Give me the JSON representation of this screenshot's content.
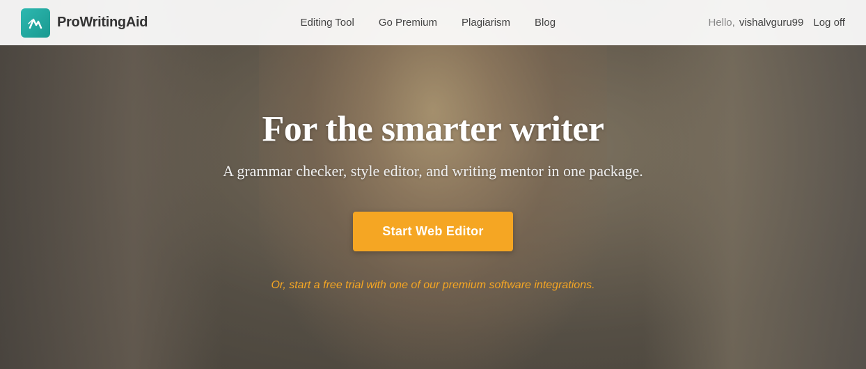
{
  "brand": {
    "name": "ProWritingAid",
    "logo_alt": "ProWritingAid logo"
  },
  "navbar": {
    "links": [
      {
        "label": "Editing Tool",
        "href": "#"
      },
      {
        "label": "Go Premium",
        "href": "#"
      },
      {
        "label": "Plagiarism",
        "href": "#"
      },
      {
        "label": "Blog",
        "href": "#"
      }
    ],
    "user": {
      "hello": "Hello,",
      "username": "vishalvguru99",
      "logoff_label": "Log off"
    }
  },
  "hero": {
    "title": "For the smarter writer",
    "subtitle": "A grammar checker, style editor, and writing mentor in one package.",
    "cta_label": "Start Web Editor",
    "footer_text": "Or, start a free trial with one of our premium software integrations."
  }
}
